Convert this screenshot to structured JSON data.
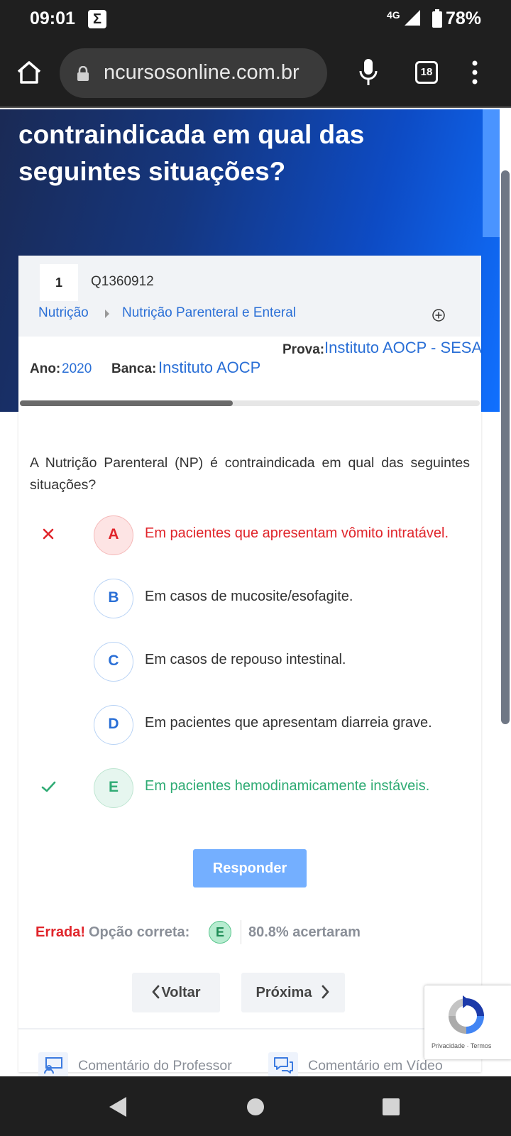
{
  "status_bar": {
    "time": "09:01",
    "notif_glyph": "Σ",
    "network": "4G",
    "battery": "78%"
  },
  "browser": {
    "url": "ncursosonline.com.br",
    "tab_count": "18"
  },
  "hero": {
    "title": "contraindicada em qual das seguintes situações?"
  },
  "question": {
    "number": "1",
    "id": "Q1360912",
    "breadcrumb": [
      "Nutrição",
      "Nutrição Parenteral e Enteral"
    ],
    "prova_label": "Prova:",
    "prova_value": "Instituto AOCP - SESA",
    "ano_label": "Ano:",
    "ano_value": "2020",
    "banca_label": "Banca:",
    "banca_value": "Instituto AOCP",
    "text": "A Nutrição Parenteral (NP) é contraindicada em qual das seguintes situações?"
  },
  "options": [
    {
      "letter": "A",
      "text": "Em pacientes que apresentam vômito intratável.",
      "state": "wrong"
    },
    {
      "letter": "B",
      "text": "Em casos de mucosite/esofagite.",
      "state": "neutral"
    },
    {
      "letter": "C",
      "text": "Em casos de repouso intestinal.",
      "state": "neutral"
    },
    {
      "letter": "D",
      "text": "Em pacientes que apresentam diarreia grave.",
      "state": "neutral"
    },
    {
      "letter": "E",
      "text": "Em pacientes hemodinamicamente instáveis.",
      "state": "right"
    }
  ],
  "answer_button": "Responder",
  "result": {
    "status": "Errada!",
    "correct_label": "Opção correta:",
    "correct_letter": "E",
    "percent_text": "80.8% acertaram"
  },
  "nav": {
    "back": "Voltar",
    "next": "Próxima"
  },
  "tabs": [
    "Comentário do Professor",
    "Comentário em Vídeo"
  ],
  "recaptcha": {
    "privacy": "Privacidade",
    "separator": "·",
    "terms": "Termos"
  },
  "colors": {
    "accent": "#2a6fd6",
    "wrong": "#e0252b",
    "right": "#2fab74",
    "button": "#74afff"
  }
}
